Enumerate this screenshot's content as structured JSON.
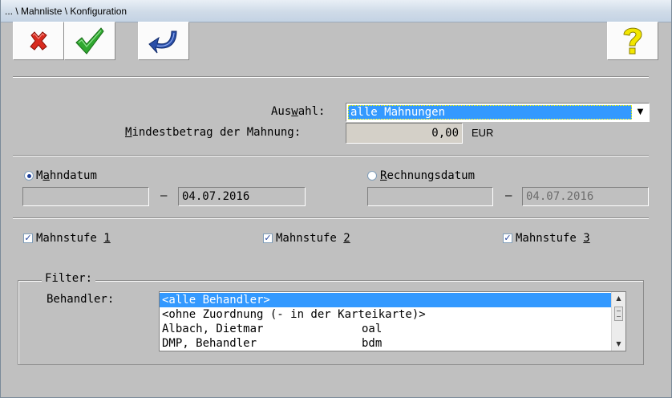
{
  "window": {
    "title": "... \\ Mahnliste \\ Konfiguration"
  },
  "toolbar": {
    "cancel_icon": "red-x-icon",
    "ok_icon": "green-check-icon",
    "back_icon": "undo-arrow-icon",
    "help_icon": "yellow-question-icon"
  },
  "auswahl": {
    "label_pre": "Aus",
    "label_u": "w",
    "label_post": "ahl:",
    "value": "alle Mahnungen"
  },
  "mindest": {
    "label_pre": "",
    "label_u": "M",
    "label_post": "indestbetrag der Mahnung:",
    "value": "0,00",
    "unit": "EUR"
  },
  "mahndatum": {
    "label_pre": "M",
    "label_u": "a",
    "label_post": "hndatum",
    "selected": true,
    "from": "",
    "dash": "–",
    "to": "04.07.2016"
  },
  "rechnungsdatum": {
    "label_pre": "",
    "label_u": "R",
    "label_post": "echnungsdatum",
    "selected": false,
    "from": "",
    "dash": "–",
    "to": "04.07.2016"
  },
  "mahnstufen": [
    {
      "label": "Mahnstufe ",
      "num": "1",
      "checked": true
    },
    {
      "label": "Mahnstufe ",
      "num": "2",
      "checked": true
    },
    {
      "label": "Mahnstufe ",
      "num": "3",
      "checked": true
    }
  ],
  "filter": {
    "group_label": "Filter:",
    "behandler_label": "Behandler:",
    "items": [
      {
        "name": "<alle Behandler>",
        "code": "",
        "selected": true
      },
      {
        "name": "<ohne Zuordnung (- in der Karteikarte)>",
        "code": "",
        "selected": false
      },
      {
        "name": "Albach, Dietmar",
        "code": "oal",
        "selected": false
      },
      {
        "name": "DMP, Behandler",
        "code": "bdm",
        "selected": false
      }
    ]
  },
  "colors": {
    "selection": "#3399ff",
    "background": "#c0c0c0"
  }
}
